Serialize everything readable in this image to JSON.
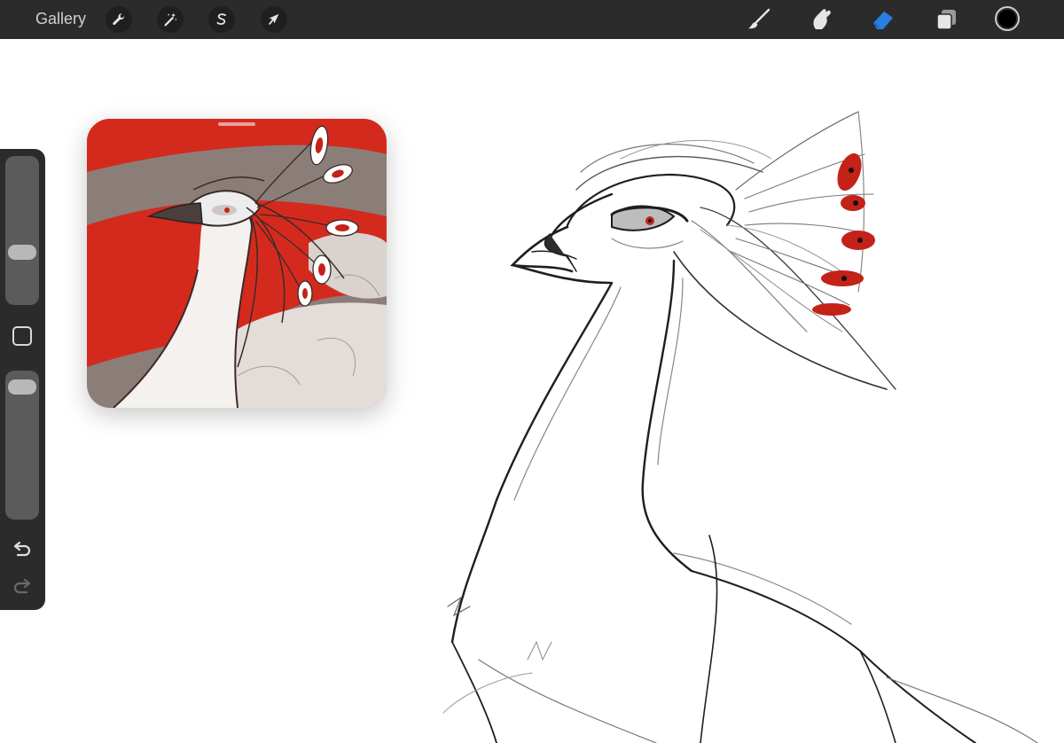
{
  "toolbar": {
    "gallery_label": "Gallery",
    "left_tools": [
      {
        "name": "actions",
        "icon": "wrench-icon"
      },
      {
        "name": "adjustments",
        "icon": "magic-wand-icon"
      },
      {
        "name": "selection",
        "icon": "selection-s-icon"
      },
      {
        "name": "transform",
        "icon": "arrow-cursor-icon"
      }
    ],
    "right_tools": [
      {
        "name": "brush",
        "icon": "brush-icon",
        "active": false
      },
      {
        "name": "smudge",
        "icon": "smudge-finger-icon",
        "active": false
      },
      {
        "name": "eraser",
        "icon": "eraser-icon",
        "active": true
      },
      {
        "name": "layers",
        "icon": "layers-icon",
        "active": false
      }
    ],
    "current_color": "#000000",
    "active_color": "#2a7de1"
  },
  "sidebar": {
    "brush_size_level": 0.33,
    "opacity_level": 0.05,
    "modify_icon": "square-modifier-icon",
    "undo_icon": "undo-icon",
    "redo_icon": "redo-icon"
  },
  "reference_window": {
    "accent_red": "#d42a1e",
    "backdrop_gray": "#8b7e79"
  }
}
